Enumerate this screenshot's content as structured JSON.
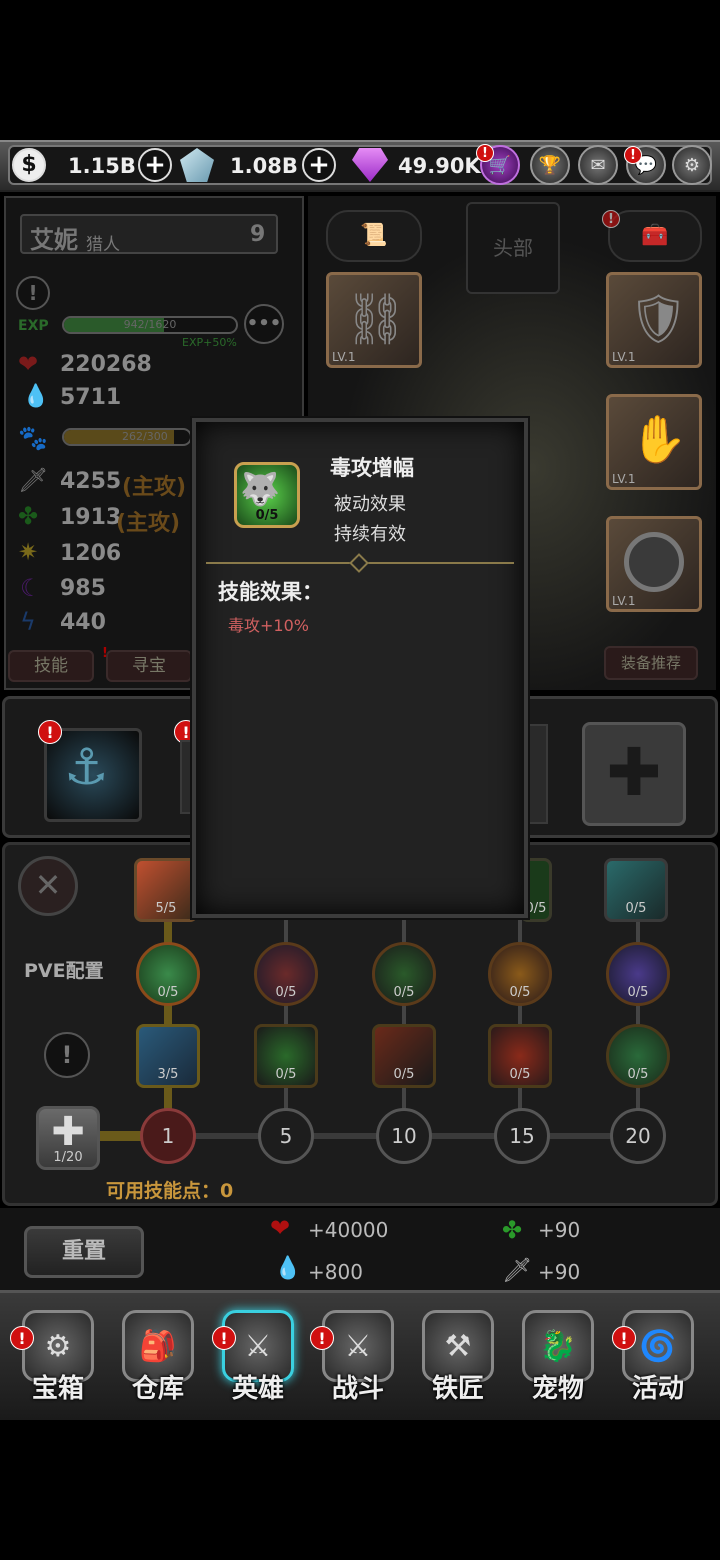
{
  "currency": {
    "gold": "1.15B",
    "crystal": "1.08B",
    "gem": "49.90K"
  },
  "hero": {
    "name": "艾妮",
    "class": "猎人",
    "level": "9",
    "exp_label": "EXP",
    "exp_text": "942/1620",
    "exp_progress": 0.58,
    "exp_bonus": "EXP+50%",
    "pet_bar_text": "262/300",
    "pet_progress": 0.87
  },
  "stats": {
    "hp": "220268",
    "mp": "5711",
    "attack": "4255",
    "attack_tag": "(主攻)",
    "poison": "1913",
    "poison_tag": "(主攻)",
    "crit": "1206",
    "magic": "985",
    "speed": "440"
  },
  "tabs": {
    "skill": "技能",
    "treasure": "寻宝",
    "equip_recommend": "装备推荐"
  },
  "equipment": {
    "head_label": "头部",
    "lv_text": "LV.1"
  },
  "skill_tree": {
    "pve_label": "PVE配置",
    "row1": [
      "5/5",
      "0/5",
      "0/5"
    ],
    "row2": [
      "0/5",
      "0/5",
      "0/5",
      "0/5",
      "0/5"
    ],
    "row3": [
      "3/5",
      "0/5",
      "0/5",
      "0/5",
      "0/5"
    ],
    "milestones": [
      "1",
      "5",
      "10",
      "15",
      "20"
    ],
    "slot_count": "1/20",
    "points_label": "可用技能点：",
    "points_value": "0"
  },
  "reset": {
    "label": "重置",
    "hp_bonus": "+40000",
    "mp_bonus": "+800",
    "poison_bonus": "+90",
    "attack_bonus": "+90"
  },
  "popup": {
    "title": "毒攻增幅",
    "type": "被动效果",
    "duration": "持续有效",
    "level": "0/5",
    "effect_header": "技能效果：",
    "effect": "毒攻+10%"
  },
  "nav": [
    "宝箱",
    "仓库",
    "英雄",
    "战斗",
    "铁匠",
    "宠物",
    "活动"
  ],
  "colors": {
    "accent_green": "#3a9a3a",
    "gold_text": "#c8963c",
    "badge_red": "#d01010",
    "popup_effect": "#d06060"
  }
}
